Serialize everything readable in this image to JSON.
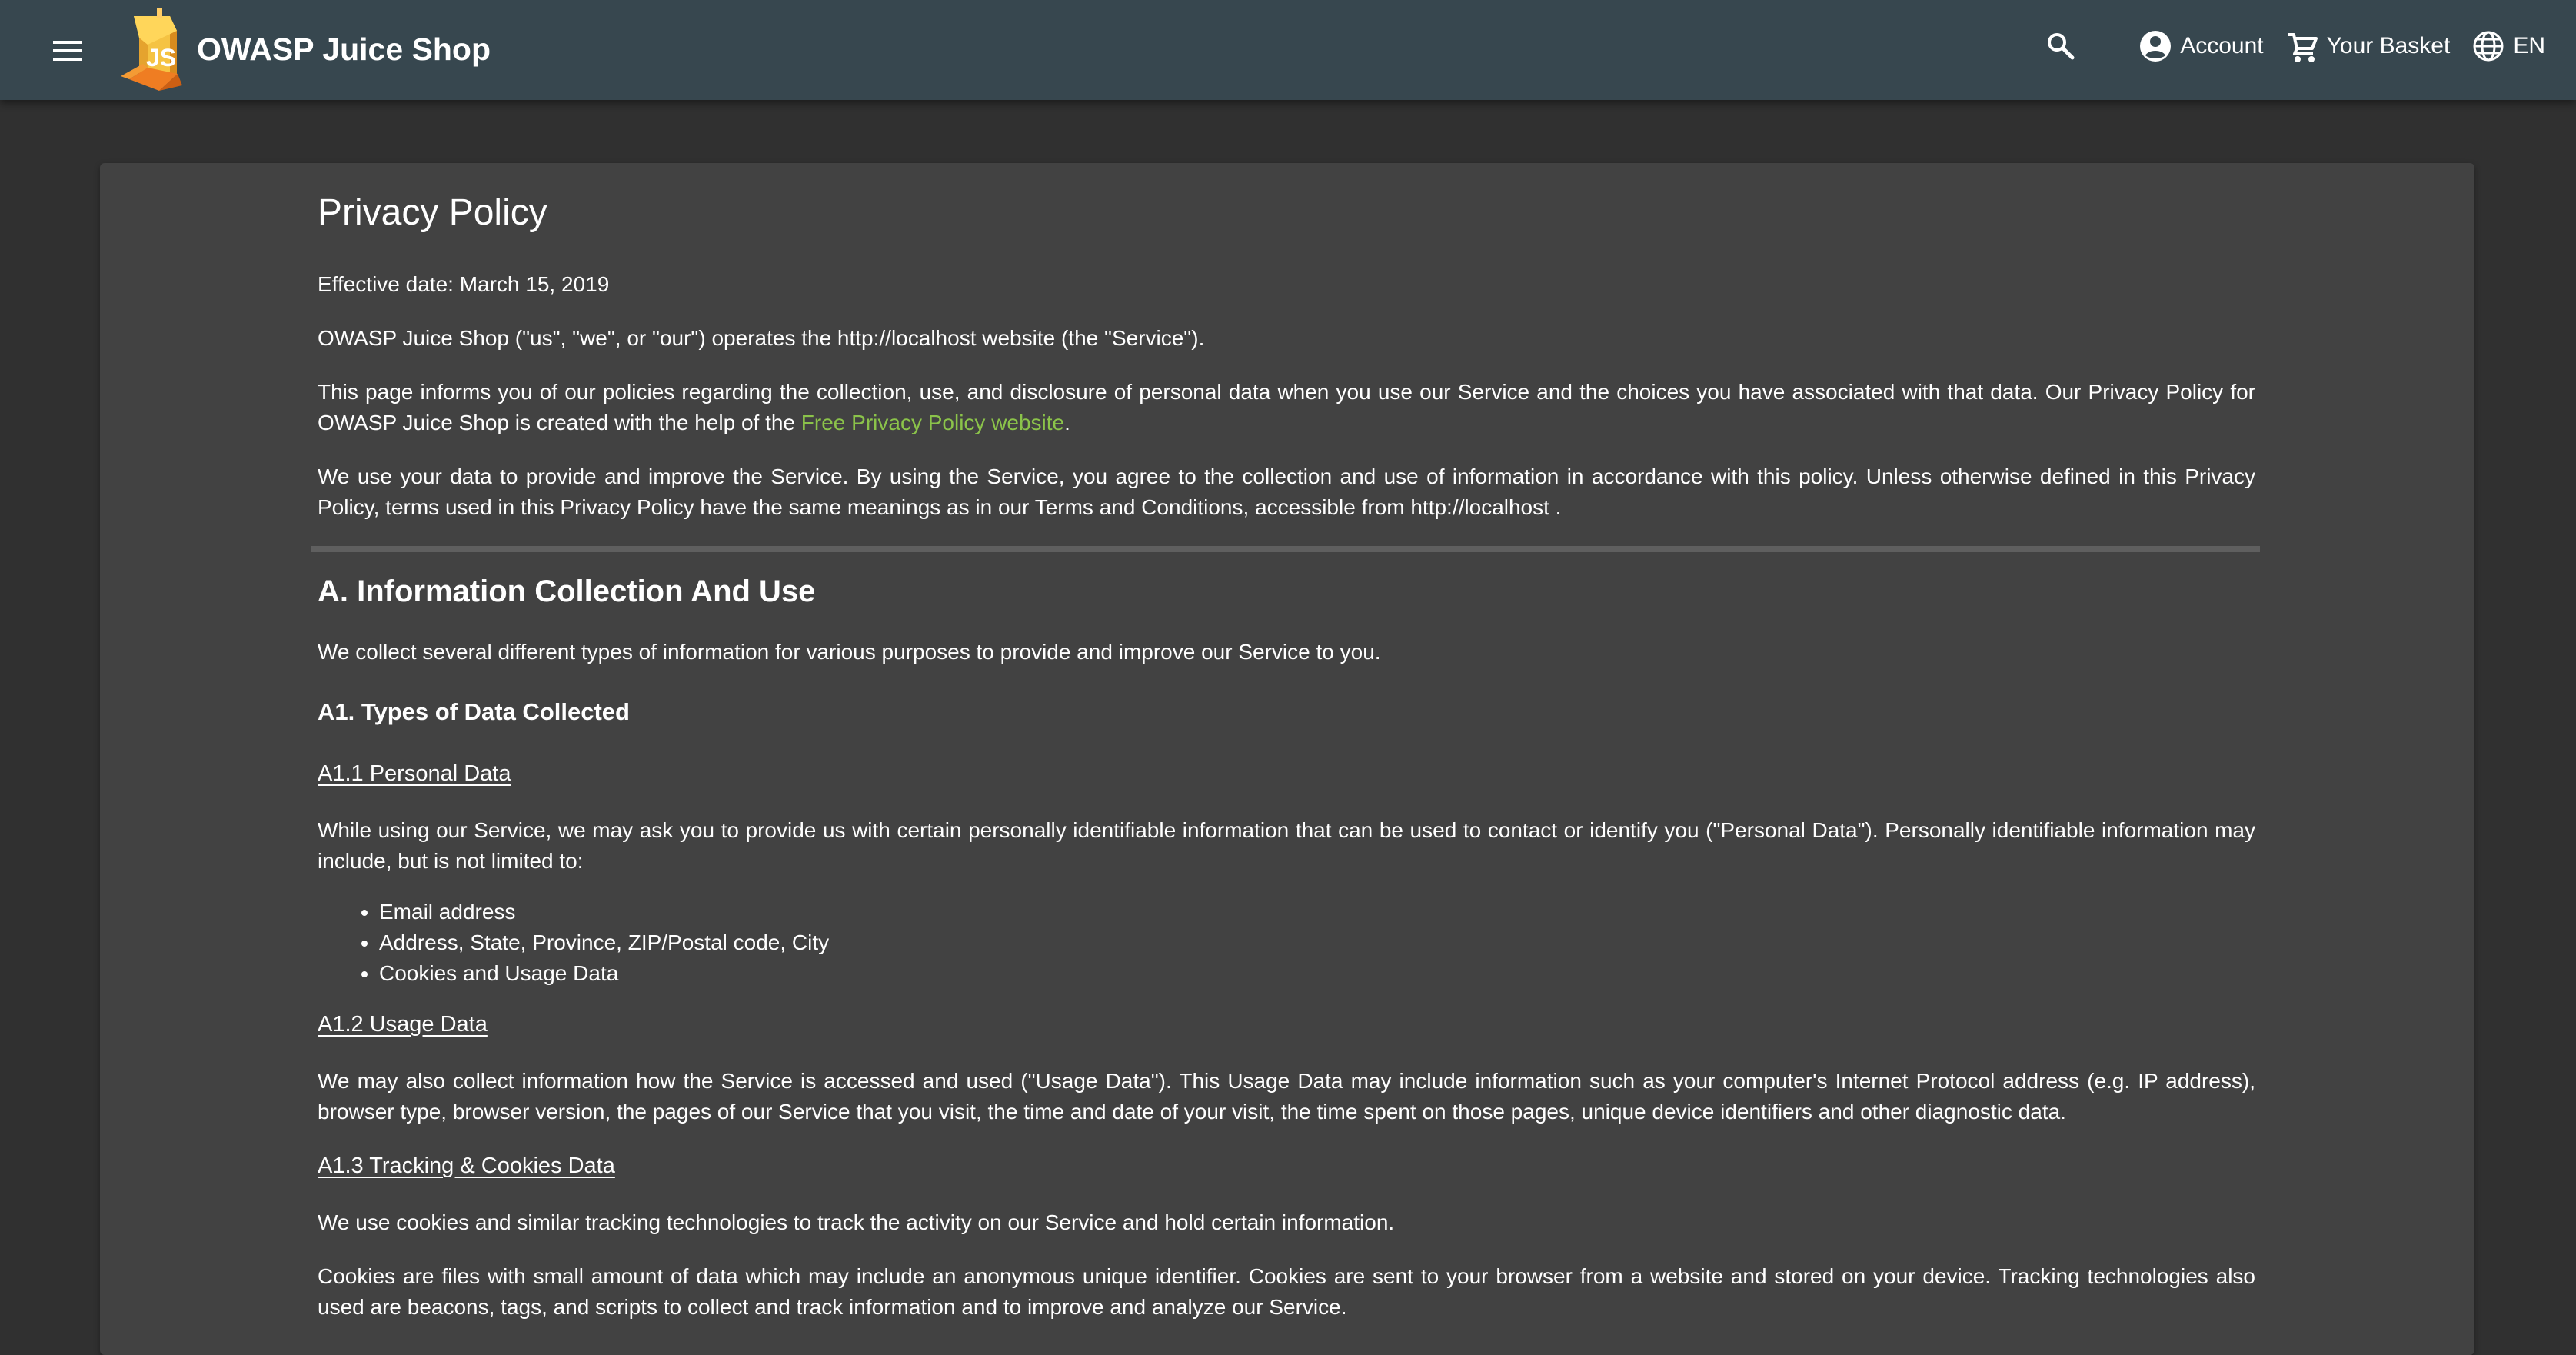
{
  "toolbar": {
    "title": "OWASP Juice Shop",
    "menu_icon": "hamburger-menu-icon",
    "logo_text": "JS",
    "search_icon": "search-icon",
    "account_label": "Account",
    "account_icon": "account-circle-icon",
    "basket_label": "Your Basket",
    "basket_icon": "shopping-cart-icon",
    "language_label": "EN",
    "language_icon": "globe-icon",
    "colors": {
      "bar": "#37474f",
      "logo_orange": "#f28a1a",
      "logo_yellow": "#f6c443"
    }
  },
  "page": {
    "title": "Privacy Policy",
    "effective_date": "Effective date: March 15, 2019",
    "operator_statement": "OWASP Juice Shop (\"us\", \"we\", or \"our\") operates the http://localhost website (the \"Service\").",
    "policy_intro_before_link": "This page informs you of our policies regarding the collection, use, and disclosure of personal data when you use our Service and the choices you have associated with that data. Our Privacy Policy for OWASP Juice Shop is created with the help of the ",
    "policy_link_text": "Free Privacy Policy website",
    "policy_intro_after_link": ".",
    "usage_agreement": "We use your data to provide and improve the Service. By using the Service, you agree to the collection and use of information in accordance with this policy. Unless otherwise defined in this Privacy Policy, terms used in this Privacy Policy have the same meanings as in our Terms and Conditions, accessible from http://localhost .",
    "section_a_title": "A. Information Collection And Use",
    "section_a_intro": "We collect several different types of information for various purposes to provide and improve our Service to you.",
    "section_a1_title": "A1. Types of Data Collected",
    "personal_data_title": "A1.1 Personal Data",
    "personal_data_text": "While using our Service, we may ask you to provide us with certain personally identifiable information that can be used to contact or identify you (\"Personal Data\"). Personally identifiable information may include, but is not limited to:",
    "personal_data_items": [
      "Email address",
      "Address, State, Province, ZIP/Postal code, City",
      "Cookies and Usage Data"
    ],
    "usage_data_title": "A1.2 Usage Data",
    "usage_data_text": "We may also collect information how the Service is accessed and used (\"Usage Data\"). This Usage Data may include information such as your computer's Internet Protocol address (e.g. IP address), browser type, browser version, the pages of our Service that you visit, the time and date of your visit, the time spent on those pages, unique device identifiers and other diagnostic data.",
    "tracking_title": "A1.3 Tracking & Cookies Data",
    "tracking_text": "We use cookies and similar tracking technologies to track the activity on our Service and hold certain information.",
    "cookies_text": "Cookies are files with small amount of data which may include an anonymous unique identifier. Cookies are sent to your browser from a website and stored on your device. Tracking technologies also used are beacons, tags, and scripts to collect and track information and to improve and analyze our Service.",
    "colors": {
      "background": "#303030",
      "card": "#424242",
      "link": "#8bc34a",
      "rule": "#5f5f5f"
    }
  }
}
